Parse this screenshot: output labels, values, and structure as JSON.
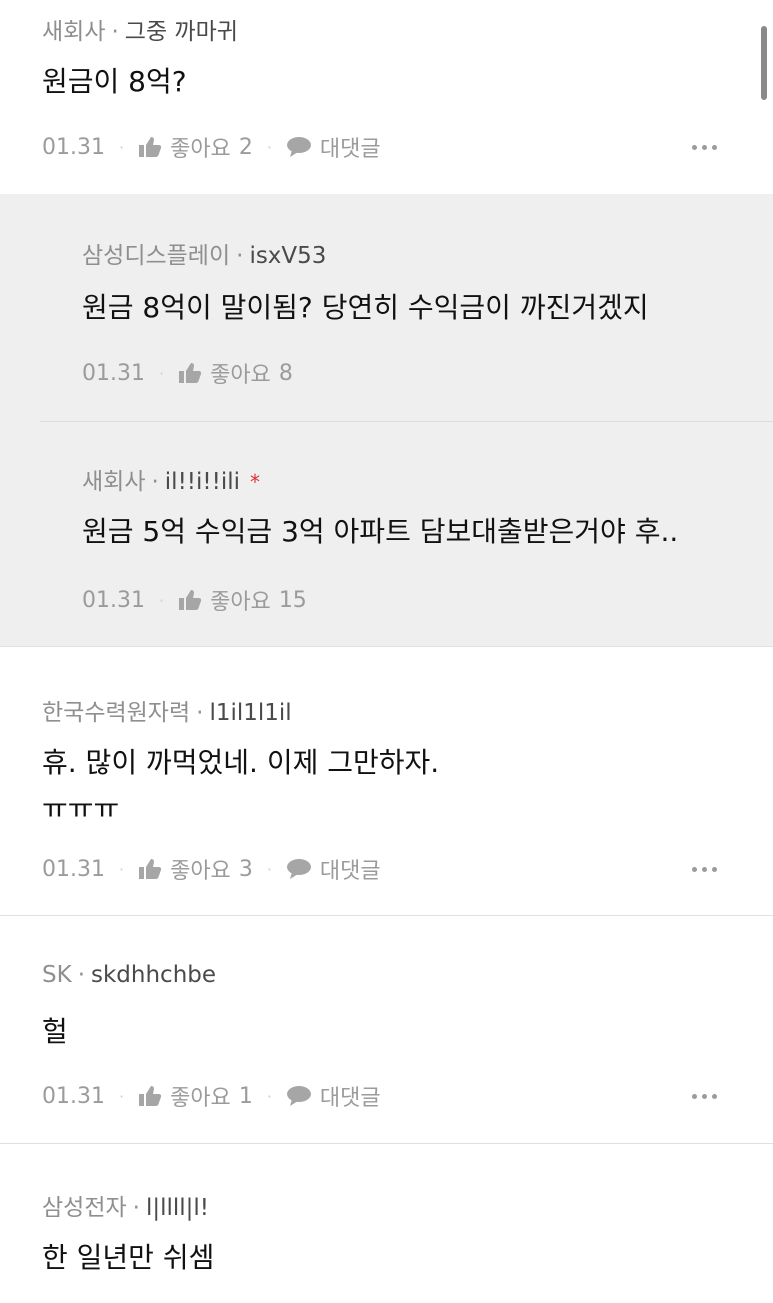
{
  "comments": [
    {
      "company": "새회사",
      "nick": "그중 까마귀",
      "text": "원금이 8억?",
      "date": "01.31",
      "like_label": "좋아요",
      "like_count": "2",
      "reply_label": "대댓글"
    },
    {
      "company": "한국수력원자력",
      "nick": "l1il1l1il",
      "text": "휴. 많이 까먹었네.  이제 그만하자.",
      "text2": "ㅠㅠㅠ",
      "date": "01.31",
      "like_label": "좋아요",
      "like_count": "3",
      "reply_label": "대댓글"
    },
    {
      "company": "SK",
      "nick": "skdhhchbe",
      "text": "헐",
      "date": "01.31",
      "like_label": "좋아요",
      "like_count": "1",
      "reply_label": "대댓글"
    },
    {
      "company": "삼성전자",
      "nick": "l|llll|l!",
      "text": "한 일년만 쉬셈"
    }
  ],
  "replies": [
    {
      "company": "삼성디스플레이",
      "nick": "isxV53",
      "text": "원금 8억이 말이됨? 당연히 수익금이 까진거겠지",
      "date": "01.31",
      "like_label": "좋아요",
      "like_count": "8"
    },
    {
      "company": "새회사",
      "nick": "il!!i!!ili",
      "author_mark": "*",
      "text": "원금 5억   수익금 3억  아파트 담보대출받은거야 후..",
      "date": "01.31",
      "like_label": "좋아요",
      "like_count": "15"
    }
  ],
  "separator": "·",
  "icons": {
    "like": "thumbs-up-icon",
    "reply": "speech-bubble-icon",
    "more": "more-horizontal-icon"
  },
  "colors": {
    "reply_background": "#efefef",
    "author_mark": "#dd3333"
  }
}
